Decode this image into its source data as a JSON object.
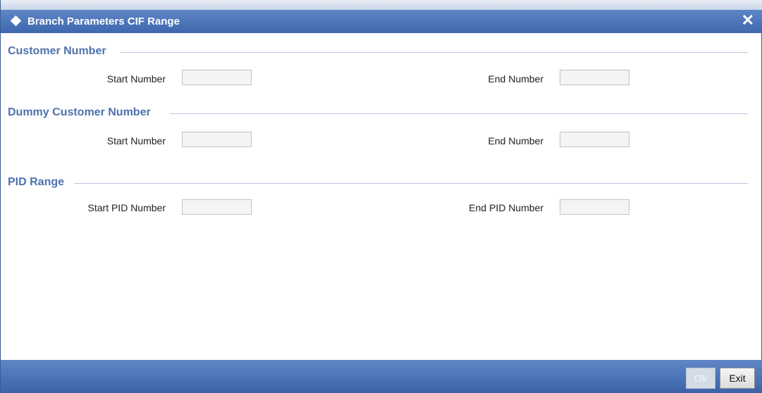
{
  "window": {
    "title": "Branch Parameters CIF Range",
    "close_symbol": "✕"
  },
  "sections": [
    {
      "title": "Customer Number",
      "start_label": "Start Number",
      "start_value": "",
      "end_label": "End Number",
      "end_value": ""
    },
    {
      "title": "Dummy Customer Number",
      "start_label": "Start Number",
      "start_value": "",
      "end_label": "End Number",
      "end_value": ""
    },
    {
      "title": "PID Range",
      "start_label": "Start PID Number",
      "start_value": "",
      "end_label": "End PID Number",
      "end_value": ""
    }
  ],
  "footer": {
    "ok_label": "Ok",
    "exit_label": "Exit"
  },
  "colors": {
    "titlebar": "#4a72b6",
    "section_title": "#4f72ad",
    "footer": "#4a72b6"
  },
  "icons": {
    "title": "diamond-icon",
    "close": "close-icon"
  }
}
